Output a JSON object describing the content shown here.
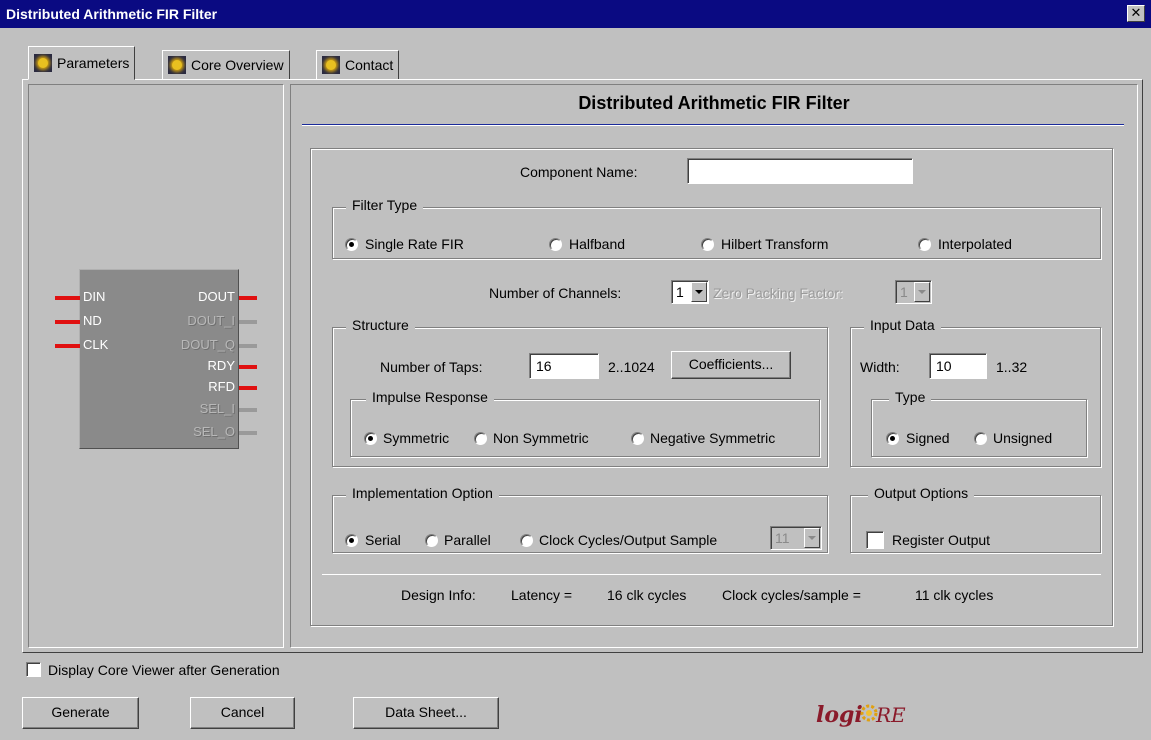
{
  "window": {
    "title": "Distributed Arithmetic FIR Filter"
  },
  "tabs": [
    {
      "label": "Parameters",
      "active": true
    },
    {
      "label": "Core Overview",
      "active": false
    },
    {
      "label": "Contact",
      "active": false
    }
  ],
  "symbol": {
    "inputs": [
      "DIN",
      "ND",
      "CLK"
    ],
    "outputs": [
      "DOUT",
      "DOUT_I",
      "DOUT_Q",
      "RDY",
      "RFD",
      "SEL_I",
      "SEL_O"
    ]
  },
  "panel": {
    "heading": "Distributed Arithmetic FIR Filter",
    "component_name": {
      "label": "Component Name:",
      "value": ""
    },
    "filter_type": {
      "legend": "Filter Type",
      "options": [
        "Single Rate FIR",
        "Halfband",
        "Hilbert Transform",
        "Interpolated"
      ],
      "selected": "Single Rate FIR"
    },
    "channels": {
      "label": "Number of Channels:",
      "value": "1"
    },
    "zero_packing": {
      "label": "Zero Packing Factor:",
      "value": "1"
    },
    "structure": {
      "legend": "Structure",
      "taps_label": "Number of Taps:",
      "taps_value": "16",
      "taps_range": "2..1024",
      "coefficients_button": "Coefficients...",
      "impulse": {
        "legend": "Impulse Response",
        "options": [
          "Symmetric",
          "Non Symmetric",
          "Negative Symmetric"
        ],
        "selected": "Symmetric"
      }
    },
    "input_data": {
      "legend": "Input Data",
      "width_label": "Width:",
      "width_value": "10",
      "width_range": "1..32",
      "type": {
        "legend": "Type",
        "options": [
          "Signed",
          "Unsigned"
        ],
        "selected": "Signed"
      }
    },
    "implementation": {
      "legend": "Implementation Option",
      "options": [
        "Serial",
        "Parallel",
        "Clock Cycles/Output Sample"
      ],
      "selected": "Serial",
      "clock_cycles_value": "11"
    },
    "output_options": {
      "legend": "Output Options",
      "register_output_label": "Register Output",
      "register_output_checked": false
    },
    "design_info": {
      "label": "Design Info:",
      "latency_label": "Latency =",
      "latency_value": "16 clk cycles",
      "ccs_label": "Clock cycles/sample =",
      "ccs_value": "11 clk cycles"
    }
  },
  "footer": {
    "display_viewer_label": "Display Core Viewer after Generation",
    "display_viewer_checked": false,
    "buttons": {
      "generate": "Generate",
      "cancel": "Cancel",
      "data_sheet": "Data Sheet..."
    },
    "logo": "LogiCORE"
  },
  "colors": {
    "title_bar": "#0a0a82",
    "pin_active": "#e01010",
    "heading_rule": "#1a2a9a",
    "logo": "#8a1a2a"
  }
}
